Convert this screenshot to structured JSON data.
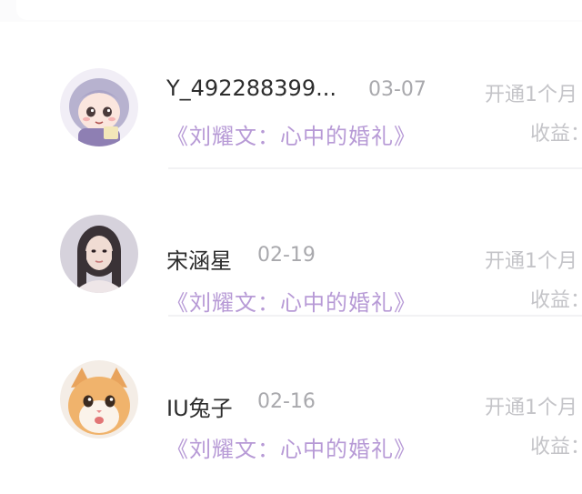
{
  "subscriptions": [
    {
      "username": "Y_492288399...",
      "date": "03-07",
      "work_title": "《刘耀文：心中的婚礼》",
      "plan_text": "开通1个月",
      "income_label": "收益：",
      "avatar_icon": "anime-girl-avatar"
    },
    {
      "username": "宋涵星",
      "date": "02-19",
      "work_title": "《刘耀文：心中的婚礼》",
      "plan_text": "开通1个月",
      "income_label": "收益：",
      "avatar_icon": "girl-photo-avatar"
    },
    {
      "username": "IU兔子",
      "date": "02-16",
      "work_title": "《刘耀文：心中的婚礼》",
      "plan_text": "开通1个月",
      "income_label": "收益：",
      "avatar_icon": "cat-photo-avatar"
    }
  ],
  "colors": {
    "title_purple": "#b79ad6",
    "name_dark": "#2d2d2d",
    "muted_gray": "#a9a9ad",
    "light_gray": "#c4c4c8"
  }
}
